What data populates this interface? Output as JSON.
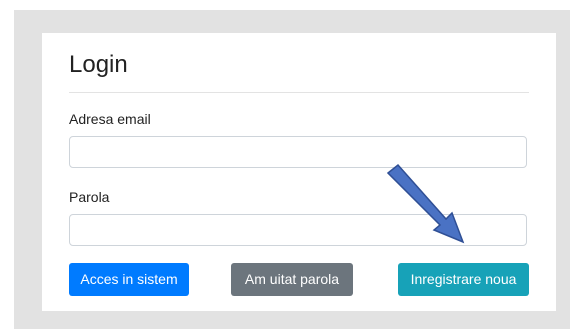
{
  "login": {
    "title": "Login",
    "email_label": "Adresa email",
    "email_value": "",
    "password_label": "Parola",
    "password_value": "",
    "submit_label": "Acces in sistem",
    "forgot_label": "Am uitat parola",
    "register_label": "Inregistrare noua"
  },
  "annotation": {
    "arrow_color": "#4a72c4",
    "arrow_icon": "diagonal-arrow-icon"
  },
  "colors": {
    "primary": "#007bff",
    "secondary": "#6c757d",
    "info": "#17a2b8",
    "backdrop": "#e2e2e2"
  }
}
